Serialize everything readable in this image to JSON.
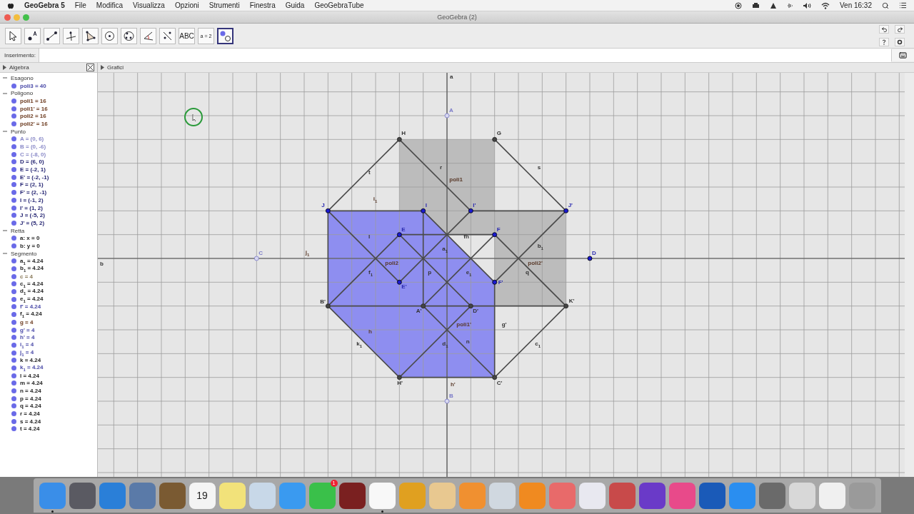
{
  "menu_bar": {
    "app": "GeoGebra 5",
    "items": [
      "File",
      "Modifica",
      "Visualizza",
      "Opzioni",
      "Strumenti",
      "Finestra",
      "Guida",
      "GeoGebraTube"
    ],
    "clock": "Ven 16:32"
  },
  "window": {
    "title": "GeoGebra (2)"
  },
  "toolbar": {
    "tools": [
      {
        "kind": "move",
        "selected": false
      },
      {
        "kind": "point",
        "selected": false
      },
      {
        "kind": "line",
        "selected": false
      },
      {
        "kind": "perpendicular",
        "selected": false
      },
      {
        "kind": "polygon",
        "selected": false
      },
      {
        "kind": "circle",
        "selected": false
      },
      {
        "kind": "conic",
        "selected": false
      },
      {
        "kind": "angle",
        "selected": false
      },
      {
        "kind": "reflect",
        "selected": false
      },
      {
        "kind": "text",
        "label": "ABC",
        "selected": false
      },
      {
        "kind": "slider",
        "label": "a = 2",
        "selected": false
      },
      {
        "kind": "show-hide",
        "selected": true
      }
    ]
  },
  "input_bar": {
    "label": "Inserimento:"
  },
  "algebra": {
    "title": "Algebra",
    "groups": [
      {
        "name": "Esagono",
        "expanded": true,
        "items": [
          {
            "text": "poli3 = 40",
            "color": "#4a4aa8"
          }
        ]
      },
      {
        "name": "Poligono",
        "expanded": true,
        "items": [
          {
            "text": "poli1 = 16",
            "color": "#6b3a1e"
          },
          {
            "text": "poli1' = 16",
            "color": "#6b3a1e"
          },
          {
            "text": "poli2 = 16",
            "color": "#6b3a1e"
          },
          {
            "text": "poli2' = 16",
            "color": "#6b3a1e"
          }
        ]
      },
      {
        "name": "Punto",
        "expanded": true,
        "items": [
          {
            "text": "A = (0, 6)",
            "color": "#8a8ac8"
          },
          {
            "text": "B = (0, -6)",
            "color": "#8a8ac8"
          },
          {
            "text": "C = (-8, 0)",
            "color": "#8a8ac8"
          },
          {
            "text": "D = (6, 0)",
            "color": "#1e1e6e"
          },
          {
            "text": "E = (-2, 1)",
            "color": "#1e1e6e"
          },
          {
            "text": "E' = (-2, -1)",
            "color": "#1e1e6e"
          },
          {
            "text": "F = (2, 1)",
            "color": "#1e1e6e"
          },
          {
            "text": "F' = (2, -1)",
            "color": "#1e1e6e"
          },
          {
            "text": "I = (-1, 2)",
            "color": "#1e1e6e"
          },
          {
            "text": "I' = (1, 2)",
            "color": "#1e1e6e"
          },
          {
            "text": "J = (-5, 2)",
            "color": "#1e1e6e"
          },
          {
            "text": "J' = (5, 2)",
            "color": "#1e1e6e"
          }
        ]
      },
      {
        "name": "Retta",
        "expanded": true,
        "items": [
          {
            "text": "a: x = 0",
            "color": "#222222"
          },
          {
            "text": "b: y = 0",
            "color": "#222222"
          }
        ]
      },
      {
        "name": "Segmento",
        "expanded": true,
        "items": [
          {
            "text": "a$_{1}$ = 4.24",
            "color": "#222222"
          },
          {
            "text": "b$_{1}$ = 4.24",
            "color": "#222222"
          },
          {
            "text": "c = 4",
            "color": "#8a7a5a"
          },
          {
            "text": "c$_{1}$ = 4.24",
            "color": "#222222"
          },
          {
            "text": "d$_{1}$ = 4.24",
            "color": "#222222"
          },
          {
            "text": "e$_{1}$ = 4.24",
            "color": "#222222"
          },
          {
            "text": "f' = 4.24",
            "color": "#4a4aa8"
          },
          {
            "text": "f$_{1}$ = 4.24",
            "color": "#222222"
          },
          {
            "text": "g = 4",
            "color": "#6b3a1e"
          },
          {
            "text": "g' = 4",
            "color": "#4a4aa8"
          },
          {
            "text": "h' = 4",
            "color": "#4a4aa8"
          },
          {
            "text": "i$_{1}$ = 4",
            "color": "#4a4aa8"
          },
          {
            "text": "j$_{1}$ = 4",
            "color": "#4a4aa8"
          },
          {
            "text": "k = 4.24",
            "color": "#222222"
          },
          {
            "text": "k$_{1}$ = 4.24",
            "color": "#4a4aa8"
          },
          {
            "text": "l = 4.24",
            "color": "#222222"
          },
          {
            "text": "m = 4.24",
            "color": "#222222"
          },
          {
            "text": "n = 4.24",
            "color": "#222222"
          },
          {
            "text": "p = 4.24",
            "color": "#222222"
          },
          {
            "text": "q = 4.24",
            "color": "#222222"
          },
          {
            "text": "r = 4.24",
            "color": "#222222"
          },
          {
            "text": "s = 4.24",
            "color": "#222222"
          },
          {
            "text": "t = 4.24",
            "color": "#222222"
          }
        ]
      }
    ]
  },
  "graphics": {
    "title": "Grafici",
    "axes": {
      "y_label": "a",
      "x_label": "b"
    },
    "polygons": [
      {
        "color": "#bcbcbc"
      },
      {
        "color": "#bcbcbc"
      },
      {
        "color": "#8e8ef0"
      }
    ],
    "points": [
      {
        "label": "A",
        "kind": "auxiliary"
      },
      {
        "label": "H",
        "kind": "dependent"
      },
      {
        "label": "G",
        "kind": "dependent"
      },
      {
        "label": "J",
        "kind": "free"
      },
      {
        "label": "I",
        "kind": "free"
      },
      {
        "label": "I'",
        "kind": "free"
      },
      {
        "label": "J'",
        "kind": "free"
      },
      {
        "label": "E",
        "kind": "free"
      },
      {
        "label": "F",
        "kind": "free"
      },
      {
        "label": "C",
        "kind": "auxiliary"
      },
      {
        "label": "D",
        "kind": "free"
      },
      {
        "label": "E'",
        "kind": "free"
      },
      {
        "label": "F'",
        "kind": "free"
      },
      {
        "label": "B'",
        "kind": "dependent"
      },
      {
        "label": "A'",
        "kind": "dependent"
      },
      {
        "label": "D'",
        "kind": "dependent"
      },
      {
        "label": "K'",
        "kind": "dependent"
      },
      {
        "label": "H'",
        "kind": "dependent"
      },
      {
        "label": "C'",
        "kind": "dependent"
      },
      {
        "label": "B",
        "kind": "auxiliary"
      }
    ],
    "segment_labels": [
      "r",
      "s",
      "t",
      "l",
      "fh",
      "a$_{1}$",
      "b$_{1}$",
      "f$_{1}$",
      "p",
      "e$_{1}$",
      "q",
      "g'",
      "k$_{1}$",
      "d$_{1}$",
      "n",
      "c$_{1}$"
    ],
    "labels": [
      "poli1",
      "i$_{1}$",
      "j$_{1}$",
      "poli2",
      "poli2'",
      "poli1'",
      "h",
      "h'"
    ]
  },
  "dock": {
    "apps": [
      {
        "color": "#3a8ee8",
        "running": true
      },
      {
        "color": "#5a5a62",
        "running": false
      },
      {
        "color": "#2a7fd8",
        "running": false
      },
      {
        "color": "#5a7aa8",
        "running": false
      },
      {
        "color": "#7a5a32",
        "running": false
      },
      {
        "color": "#f4f4f4",
        "text": "19",
        "running": false
      },
      {
        "color": "#f2e27a",
        "running": false
      },
      {
        "color": "#c8d8e8",
        "running": false
      },
      {
        "color": "#3a9af0",
        "running": false
      },
      {
        "color": "#3ac04a",
        "badge": "1",
        "running": false
      },
      {
        "color": "#7a2020",
        "running": false
      },
      {
        "color": "#f8f8f8",
        "running": true
      },
      {
        "color": "#e0a020",
        "running": false
      },
      {
        "color": "#e8c890",
        "running": false
      },
      {
        "color": "#f09030",
        "running": false
      },
      {
        "color": "#d0d8e0",
        "running": false
      },
      {
        "color": "#f08a20",
        "running": false
      },
      {
        "color": "#e86a6a",
        "running": false
      },
      {
        "color": "#e8e8f0",
        "running": false
      },
      {
        "color": "#c84a4a",
        "running": false
      },
      {
        "color": "#6a3ac8",
        "running": false
      },
      {
        "color": "#e84a8a",
        "running": false
      },
      {
        "color": "#1a5ab8",
        "running": false
      },
      {
        "color": "#2a8ef0",
        "running": false
      },
      {
        "color": "#6a6a6a",
        "running": false
      },
      {
        "color": "#d8d8d8",
        "running": false
      },
      {
        "color": "#f0f0f0",
        "running": false
      },
      {
        "color": "#9a9a9a",
        "running": false
      }
    ]
  }
}
